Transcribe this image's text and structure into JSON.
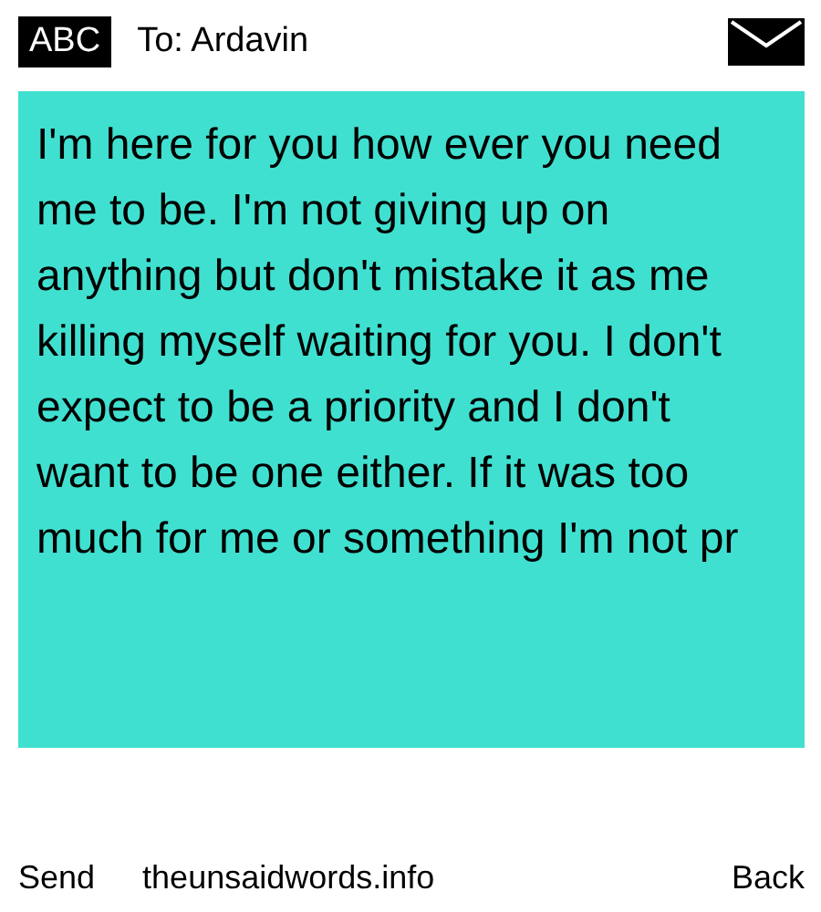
{
  "header": {
    "keyboard_mode": "ABC",
    "recipient": "To: Ardavin"
  },
  "message": {
    "text": "I'm here for you how ever you need me to be. I'm not giving up on anything but don't mistake it as me killing myself waiting for you. I don't expect to be a priority and I don't want to be one either. If it was too much for me or something I'm not pr"
  },
  "footer": {
    "left": "Send",
    "center": "theunsaidwords.info",
    "right": "Back"
  }
}
